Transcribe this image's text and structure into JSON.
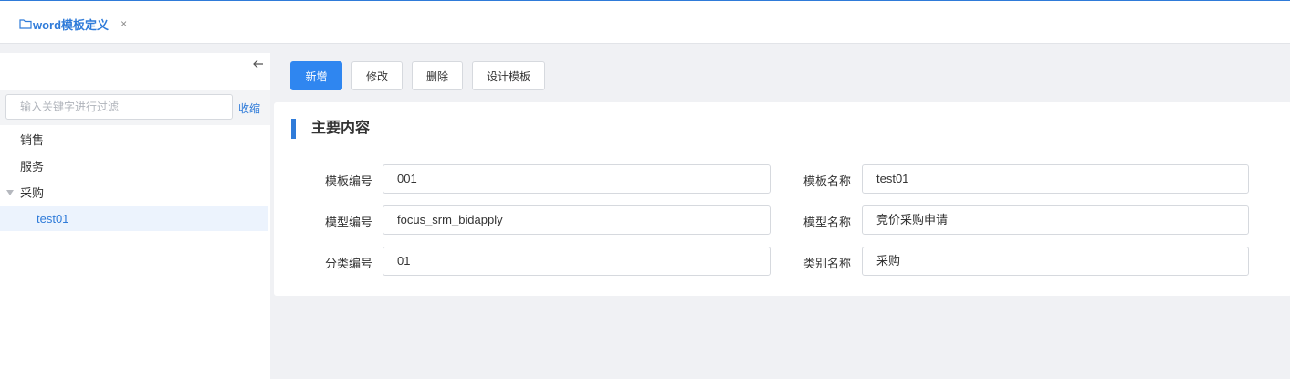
{
  "tab": {
    "title": "word模板定义",
    "close": "×"
  },
  "sidebar": {
    "filter_placeholder": "输入关键字进行过滤",
    "filter_value": "",
    "collapse_label": "收缩",
    "tree": [
      {
        "label": "销售"
      },
      {
        "label": "服务"
      },
      {
        "label": "采购",
        "expanded": true,
        "children": [
          {
            "label": "test01",
            "selected": true
          }
        ]
      }
    ]
  },
  "toolbar": {
    "add_label": "新增",
    "edit_label": "修改",
    "delete_label": "删除",
    "design_label": "设计模板"
  },
  "panel": {
    "title": "主要内容",
    "fields": {
      "template_no": {
        "label": "模板编号",
        "value": "001"
      },
      "template_name": {
        "label": "模板名称",
        "value": "test01"
      },
      "model_no": {
        "label": "模型编号",
        "value": "focus_srm_bidapply"
      },
      "model_name": {
        "label": "模型名称",
        "value": "竞价采购申请"
      },
      "category_no": {
        "label": "分类编号",
        "value": "01"
      },
      "category_name": {
        "label": "类别名称",
        "value": "采购"
      }
    }
  },
  "colors": {
    "accent": "#2f7bd9",
    "primary_button": "#2f86f0",
    "selected_row": "#ecf3fd",
    "background": "#f0f1f4"
  }
}
